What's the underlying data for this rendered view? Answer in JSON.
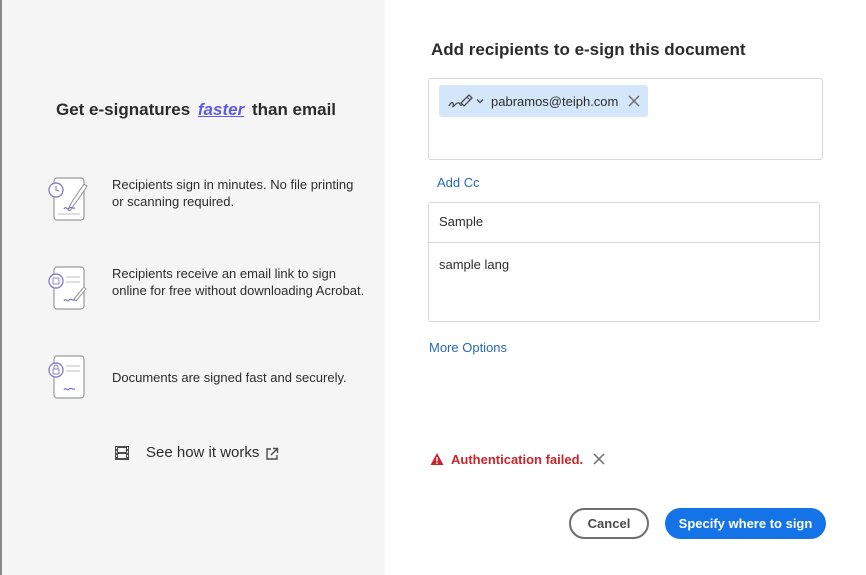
{
  "promo": {
    "title_before": "Get e-signatures",
    "title_emphasis": "faster",
    "title_after": "than email",
    "features": [
      {
        "icon": "sign-document-icon",
        "text": "Recipients sign in minutes. No file printing or scanning required."
      },
      {
        "icon": "email-link-document-icon",
        "text": "Recipients receive an email link to sign online for free without downloading Acrobat."
      },
      {
        "icon": "secure-document-icon",
        "text": "Documents are signed fast and securely."
      }
    ],
    "see_how_label": "See how it works",
    "see_how_icon": "film-icon"
  },
  "dialog": {
    "title": "Add recipients to e-sign this document",
    "recipient_email": "pabramos@teiph.com",
    "recipient_role_icon": "signer-pen-icon",
    "add_cc_label": "Add Cc",
    "subject": "Sample",
    "message": "sample lang",
    "more_options_label": "More Options",
    "error_text": "Authentication failed.",
    "cancel_label": "Cancel",
    "primary_label": "Specify where to sign"
  },
  "colors": {
    "accent": "#1473e6",
    "link": "#2a6ab5",
    "error": "#c9252d",
    "chip_bg": "#d4e6fa",
    "emphasis": "#5c5ce0"
  }
}
